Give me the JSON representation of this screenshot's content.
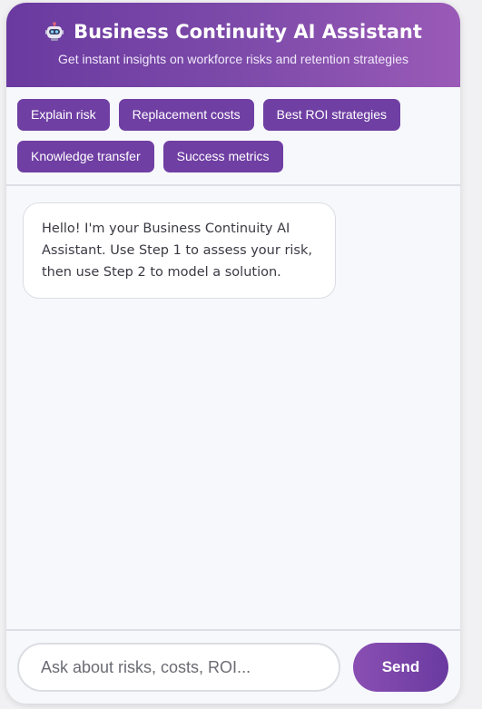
{
  "header": {
    "icon": "robot-icon",
    "title": "Business Continuity AI Assistant",
    "subtitle": "Get instant insights on workforce risks and retention strategies"
  },
  "quick_actions": [
    {
      "label": "Explain risk"
    },
    {
      "label": "Replacement costs"
    },
    {
      "label": "Best ROI strategies"
    },
    {
      "label": "Knowledge transfer"
    },
    {
      "label": "Success metrics"
    }
  ],
  "messages": [
    {
      "sender": "assistant",
      "text": "Hello! I'm your Business Continuity AI Assistant. Use Step 1 to assess your risk, then use Step 2 to model a solution."
    }
  ],
  "input": {
    "placeholder": "Ask about risks, costs, ROI...",
    "value": ""
  },
  "send_label": "Send",
  "colors": {
    "accent": "#6f3fa3",
    "header_start": "#6a3aa0",
    "header_end": "#9a5ab7"
  }
}
